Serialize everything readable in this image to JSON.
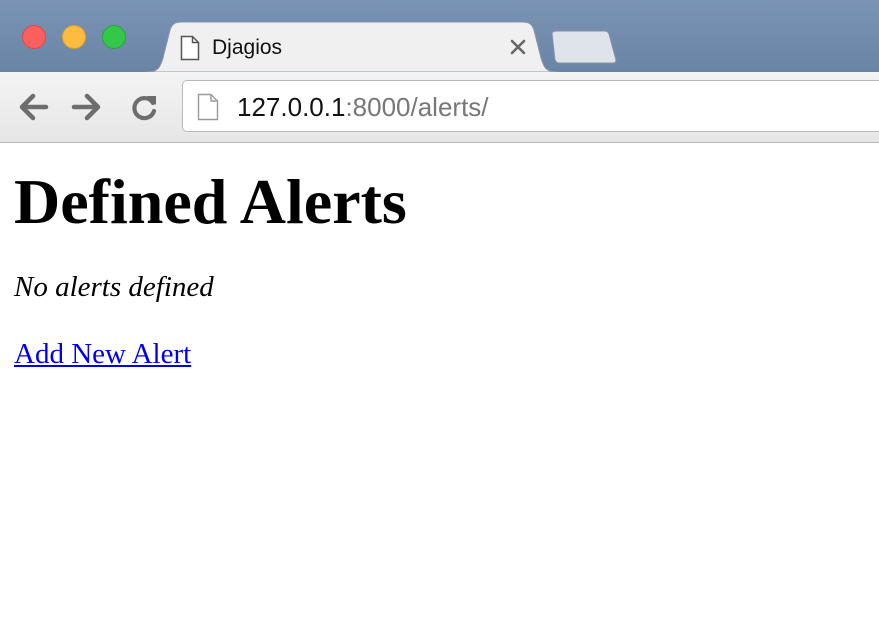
{
  "browser": {
    "tab": {
      "title": "Djagios"
    },
    "address_bar": {
      "host": "127.0.0.1",
      "path": ":8000/alerts/"
    }
  },
  "page": {
    "title": "Defined Alerts",
    "empty_message": "No alerts defined",
    "add_link_label": "Add New Alert"
  }
}
